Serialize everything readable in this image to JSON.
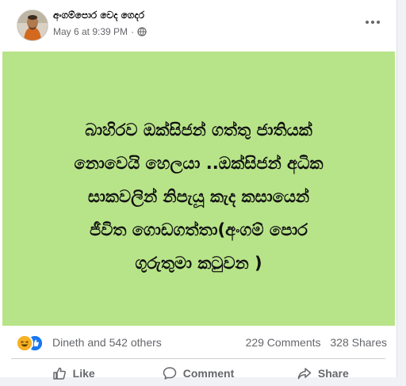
{
  "post": {
    "author": "අංගම්පොර වෙද ගෙදර",
    "time": "May 6 at 9:39 PM",
    "separator": "·",
    "privacy_icon": "globe-icon",
    "more_icon": "more-options-icon",
    "image": {
      "background_color": "#b8e489",
      "lines": [
        "බාහිරව ඔක්සිජන් ගත්තු ජාතියක්",
        "නොවෙයි හෙලයා ..ඔක්සිජන් අධික",
        "සාකවලින් නිපැයූ කැද කසායෙන්",
        "ජීවිත ගොඩගත්තා(අංගම් පොර",
        "ගුරුතුමා කටුවන )"
      ]
    },
    "reactions": {
      "icons": [
        "haha-icon",
        "like-icon"
      ],
      "summary": "Dineth and 542 others"
    },
    "comments": "229 Comments",
    "shares": "328 Shares"
  },
  "actions": {
    "like": "Like",
    "comment": "Comment",
    "share": "Share"
  },
  "colors": {
    "accent": "#1877f2",
    "muted_text": "#65676b",
    "haha": "#f7b125"
  }
}
